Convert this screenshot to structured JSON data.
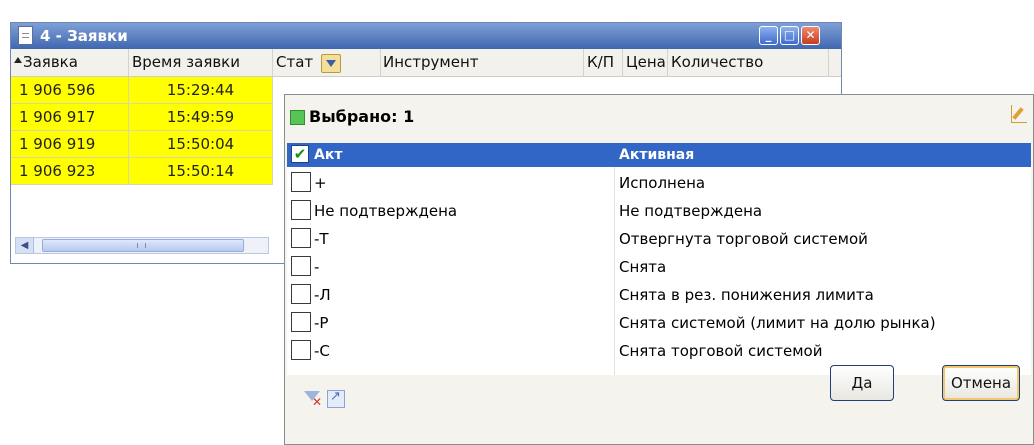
{
  "window": {
    "title": "4 - Заявки",
    "columns": [
      "Заявка",
      "Время заявки",
      "Стат",
      "Инструмент",
      "К/П",
      "Цена",
      "Количество"
    ],
    "rows": [
      {
        "order": "1 906 596",
        "time": "15:29:44"
      },
      {
        "order": "1 906 917",
        "time": "15:49:59"
      },
      {
        "order": "1 906 919",
        "time": "15:50:04"
      },
      {
        "order": "1 906 923",
        "time": "15:50:14"
      }
    ],
    "highlight_color": "#ffff00"
  },
  "popup": {
    "selected_label": "Выбрано: 1",
    "header": {
      "code": "Акт",
      "desc": "Активная",
      "checked": true
    },
    "items": [
      {
        "code": "+",
        "desc": "Исполнена",
        "checked": false
      },
      {
        "code": "Не подтверждена",
        "desc": "Не подтверждена",
        "checked": false
      },
      {
        "code": "-Т",
        "desc": "Отвергнута торговой системой",
        "checked": false
      },
      {
        "code": "-",
        "desc": "Снята",
        "checked": false
      },
      {
        "code": "-Л",
        "desc": "Снята в рез. понижения лимита",
        "checked": false
      },
      {
        "code": "-Р",
        "desc": "Снята системой (лимит на долю рынка)",
        "checked": false
      },
      {
        "code": "-С",
        "desc": "Снята торговой системой",
        "checked": false
      }
    ],
    "ok_label": "Да",
    "cancel_label": "Отмена",
    "accent_color": "#3165c6"
  }
}
